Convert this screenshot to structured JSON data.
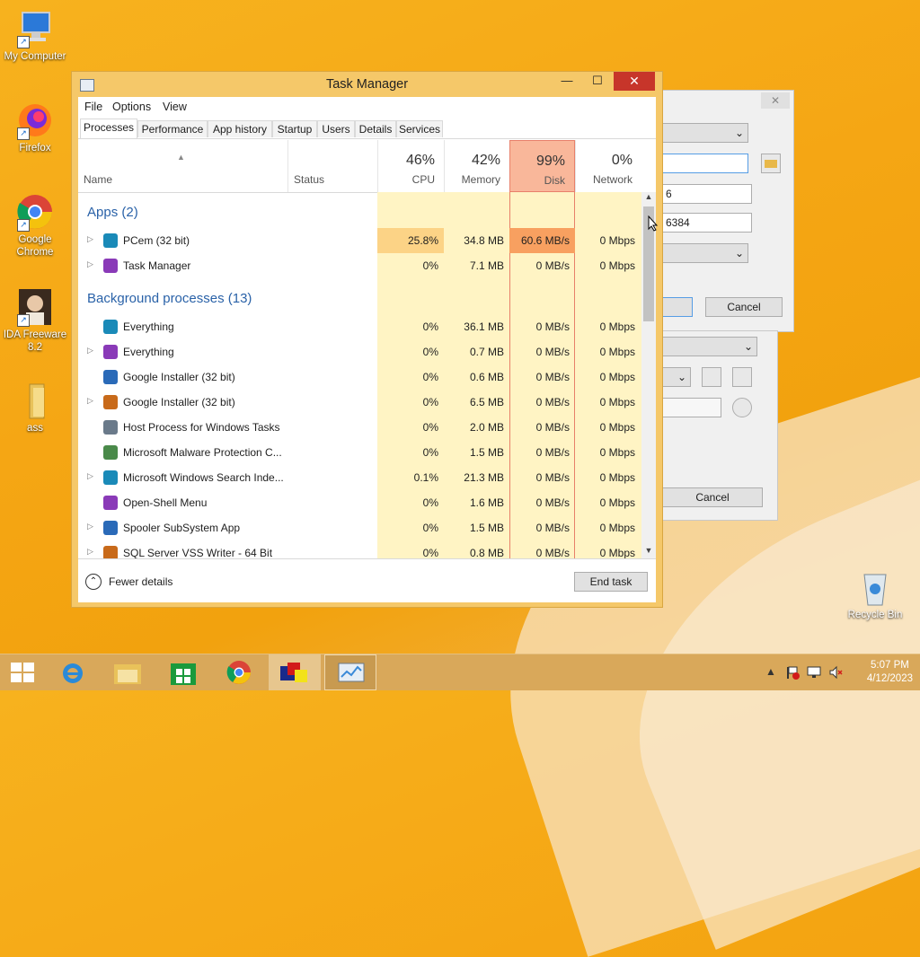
{
  "desktop": {
    "icons": [
      {
        "label": "My Computer",
        "icon": "computer-icon"
      },
      {
        "label": "Firefox",
        "icon": "firefox-icon"
      },
      {
        "label": "Google Chrome",
        "icon": "chrome-icon"
      },
      {
        "label": "IDA Freeware 8.2",
        "icon": "ida-icon"
      },
      {
        "label": "ass",
        "icon": "folder-icon"
      },
      {
        "label": "Recycle Bin",
        "icon": "recycle-bin-icon"
      }
    ],
    "bg_dialog": {
      "field_1": "6",
      "field_2": "6384",
      "cancel_1": "Cancel",
      "cancel_2": "Cancel"
    }
  },
  "window": {
    "title": "Task Manager",
    "controls": {
      "minimize": "—",
      "maximize": "☐",
      "close": "✕"
    }
  },
  "menu": {
    "file": "File",
    "options": "Options",
    "view": "View"
  },
  "tabs": [
    "Processes",
    "Performance",
    "App history",
    "Startup",
    "Users",
    "Details",
    "Services"
  ],
  "columns": {
    "name": "Name",
    "status": "Status",
    "cpu": {
      "pct": "46%",
      "label": "CPU"
    },
    "memory": {
      "pct": "42%",
      "label": "Memory"
    },
    "disk": {
      "pct": "99%",
      "label": "Disk"
    },
    "network": {
      "pct": "0%",
      "label": "Network"
    }
  },
  "groups": {
    "apps": "Apps (2)",
    "background": "Background processes (13)"
  },
  "apps": [
    {
      "name": "PCem (32 bit)",
      "expand": true,
      "cpu": "25.8%",
      "memory": "34.8 MB",
      "disk": "60.6 MB/s",
      "network": "0 Mbps"
    },
    {
      "name": "Task Manager",
      "expand": true,
      "cpu": "0%",
      "memory": "7.1 MB",
      "disk": "0 MB/s",
      "network": "0 Mbps"
    }
  ],
  "background": [
    {
      "name": "Everything",
      "expand": false,
      "cpu": "0%",
      "memory": "36.1 MB",
      "disk": "0 MB/s",
      "network": "0 Mbps"
    },
    {
      "name": "Everything",
      "expand": true,
      "cpu": "0%",
      "memory": "0.7 MB",
      "disk": "0 MB/s",
      "network": "0 Mbps"
    },
    {
      "name": "Google Installer (32 bit)",
      "expand": false,
      "cpu": "0%",
      "memory": "0.6 MB",
      "disk": "0 MB/s",
      "network": "0 Mbps"
    },
    {
      "name": "Google Installer (32 bit)",
      "expand": true,
      "cpu": "0%",
      "memory": "6.5 MB",
      "disk": "0 MB/s",
      "network": "0 Mbps"
    },
    {
      "name": "Host Process for Windows Tasks",
      "expand": false,
      "cpu": "0%",
      "memory": "2.0 MB",
      "disk": "0 MB/s",
      "network": "0 Mbps"
    },
    {
      "name": "Microsoft Malware Protection C...",
      "expand": false,
      "cpu": "0%",
      "memory": "1.5 MB",
      "disk": "0 MB/s",
      "network": "0 Mbps"
    },
    {
      "name": "Microsoft Windows Search Inde...",
      "expand": true,
      "cpu": "0.1%",
      "memory": "21.3 MB",
      "disk": "0 MB/s",
      "network": "0 Mbps"
    },
    {
      "name": "Open-Shell Menu",
      "expand": false,
      "cpu": "0%",
      "memory": "1.6 MB",
      "disk": "0 MB/s",
      "network": "0 Mbps"
    },
    {
      "name": "Spooler SubSystem App",
      "expand": true,
      "cpu": "0%",
      "memory": "1.5 MB",
      "disk": "0 MB/s",
      "network": "0 Mbps"
    },
    {
      "name": "SQL Server VSS Writer - 64 Bit",
      "expand": true,
      "cpu": "0%",
      "memory": "0.8 MB",
      "disk": "0 MB/s",
      "network": "0 Mbps"
    }
  ],
  "footer": {
    "fewer_details": "Fewer details",
    "end_task": "End task"
  },
  "taskbar": {
    "items": [
      "start-icon",
      "internet-explorer-icon",
      "file-explorer-icon",
      "store-icon",
      "chrome-icon",
      "pcem-icon",
      "task-manager-icon"
    ],
    "time": "5:07 PM",
    "date": "4/12/2023"
  },
  "colors": {
    "disk_hot": "#f8a060",
    "cpu_hot": "#fcd386",
    "heat_light": "#fff4c4",
    "accent_close": "#c7352a"
  }
}
